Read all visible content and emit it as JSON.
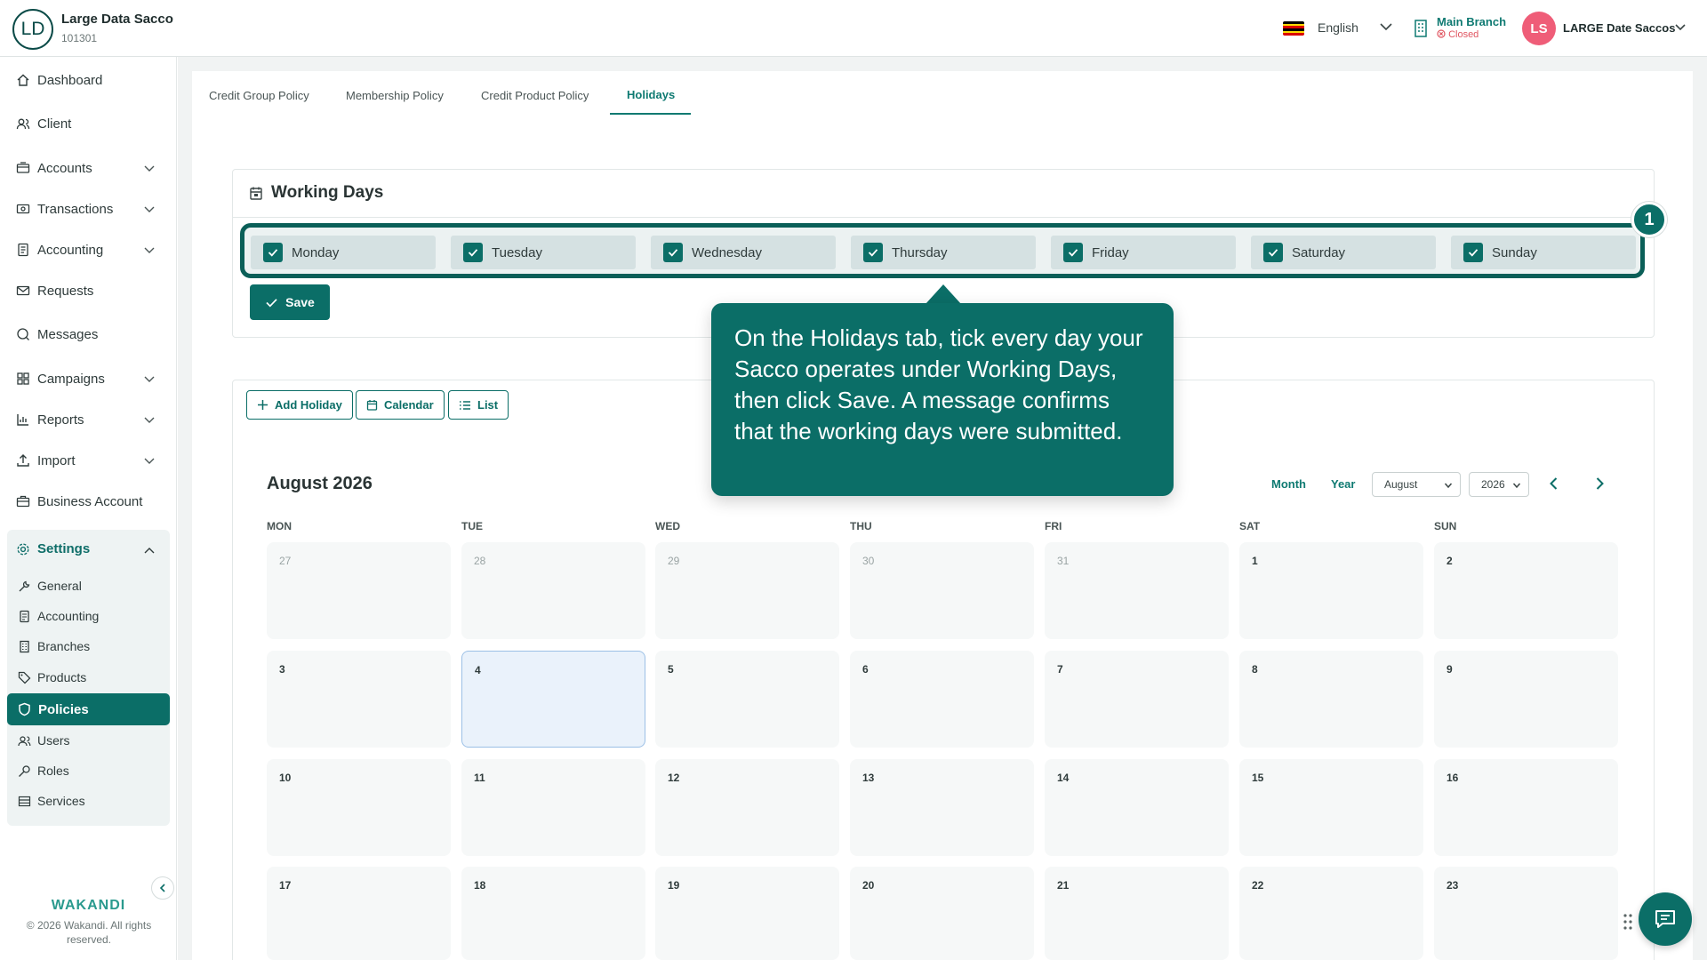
{
  "header": {
    "avatar_initials": "LD",
    "org_name": "Large Data Sacco",
    "org_code": "101301",
    "language": "English",
    "branch_name": "Main Branch",
    "branch_status": "Closed",
    "user_initials": "LS",
    "user_name": "LARGE Date Saccos"
  },
  "sidebar": {
    "items": [
      {
        "label": "Dashboard",
        "icon": "home-icon"
      },
      {
        "label": "Client",
        "icon": "users-icon"
      },
      {
        "label": "Accounts",
        "icon": "wallet-icon"
      },
      {
        "label": "Transactions",
        "icon": "cash-icon"
      },
      {
        "label": "Accounting",
        "icon": "ledger-icon"
      },
      {
        "label": "Requests",
        "icon": "mail-icon"
      },
      {
        "label": "Messages",
        "icon": "chat-icon"
      },
      {
        "label": "Campaigns",
        "icon": "grid-icon"
      },
      {
        "label": "Reports",
        "icon": "bar-chart-icon"
      },
      {
        "label": "Import",
        "icon": "upload-icon"
      },
      {
        "label": "Business Account",
        "icon": "briefcase-icon"
      }
    ],
    "settings_label": "Settings",
    "settings_items": [
      {
        "label": "General",
        "icon": "wrench-icon"
      },
      {
        "label": "Accounting",
        "icon": "ledger-icon"
      },
      {
        "label": "Branches",
        "icon": "building-icon"
      },
      {
        "label": "Products",
        "icon": "tag-icon"
      },
      {
        "label": "Policies",
        "icon": "shield-icon"
      },
      {
        "label": "Users",
        "icon": "users-icon"
      },
      {
        "label": "Roles",
        "icon": "key-icon"
      },
      {
        "label": "Services",
        "icon": "list-icon"
      }
    ],
    "footer_logo": "WAKANDI",
    "footer_copy": "© 2026 Wakandi. All rights reserved."
  },
  "tabs": [
    "Credit Group Policy",
    "Membership Policy",
    "Credit Product Policy",
    "Holidays"
  ],
  "active_tab": "Holidays",
  "working_days": {
    "title": "Working Days",
    "days": [
      {
        "label": "Monday",
        "checked": true
      },
      {
        "label": "Tuesday",
        "checked": true
      },
      {
        "label": "Wednesday",
        "checked": true
      },
      {
        "label": "Thursday",
        "checked": true
      },
      {
        "label": "Friday",
        "checked": true
      },
      {
        "label": "Saturday",
        "checked": true
      },
      {
        "label": "Sunday",
        "checked": true
      }
    ],
    "save_label": "Save",
    "step_badge": "1"
  },
  "tooltip": {
    "text": "On the Holidays tab, tick every day your Sacco operates under Working Days, then click Save. A message confirms that the working days were submitted."
  },
  "calendar": {
    "add_holiday_label": "Add Holiday",
    "calendar_label": "Calendar",
    "list_label": "List",
    "title": "August 2026",
    "month_label": "Month",
    "year_label": "Year",
    "month_select": "August",
    "year_select": "2026",
    "weekdays": [
      "MON",
      "TUE",
      "WED",
      "THU",
      "FRI",
      "SAT",
      "SUN"
    ],
    "weeks": [
      [
        "27",
        "28",
        "29",
        "30",
        "31",
        "1",
        "2"
      ],
      [
        "3",
        "4",
        "5",
        "6",
        "7",
        "8",
        "9"
      ],
      [
        "10",
        "11",
        "12",
        "13",
        "14",
        "15",
        "16"
      ],
      [
        "17",
        "18",
        "19",
        "20",
        "21",
        "22",
        "23"
      ]
    ],
    "today": "4"
  },
  "colors": {
    "primary": "#0b6e67",
    "accent_text": "#0f7a72",
    "status_closed": "#e05561",
    "user_avatar": "#ef5d78"
  }
}
